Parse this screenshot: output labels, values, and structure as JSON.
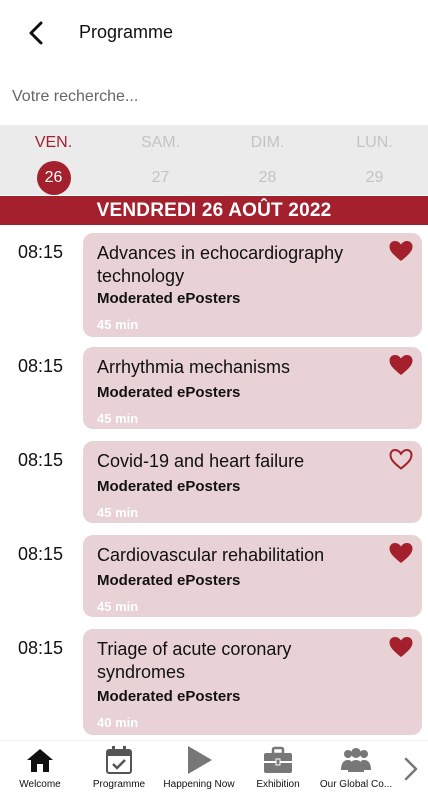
{
  "header": {
    "title": "Programme"
  },
  "search": {
    "placeholder": "Votre recherche..."
  },
  "days": [
    {
      "name": "VEN.",
      "num": "26",
      "active": true
    },
    {
      "name": "SAM.",
      "num": "27",
      "active": false
    },
    {
      "name": "DIM.",
      "num": "28",
      "active": false
    },
    {
      "name": "LUN.",
      "num": "29",
      "active": false
    }
  ],
  "date_banner": "VENDREDI 26 AOÛT 2022",
  "sessions": [
    {
      "time": "08:15",
      "title": "Advances in echocardiography technology",
      "type": "Moderated ePosters",
      "duration": "45 min",
      "favorite": true
    },
    {
      "time": "08:15",
      "title": "Arrhythmia mechanisms",
      "type": "Moderated ePosters",
      "duration": "45 min",
      "favorite": true
    },
    {
      "time": "08:15",
      "title": "Covid-19 and heart failure",
      "type": "Moderated ePosters",
      "duration": "45 min",
      "favorite": false
    },
    {
      "time": "08:15",
      "title": "Cardiovascular rehabilitation",
      "type": "Moderated ePosters",
      "duration": "45 min",
      "favorite": true
    },
    {
      "time": "08:15",
      "title": "Triage of acute coronary syndromes",
      "type": "Moderated ePosters",
      "duration": "40 min",
      "favorite": true
    }
  ],
  "tabs": [
    {
      "label": "Welcome",
      "icon": "home-icon"
    },
    {
      "label": "Programme",
      "icon": "calendar-check-icon"
    },
    {
      "label": "Happening Now",
      "icon": "play-icon"
    },
    {
      "label": "Exhibition",
      "icon": "briefcase-icon"
    },
    {
      "label": "Our Global Co...",
      "icon": "users-group-icon"
    }
  ],
  "colors": {
    "accent": "#a3202c",
    "card_bg": "#e8d2d5",
    "day_bar_bg": "#ebebeb"
  }
}
